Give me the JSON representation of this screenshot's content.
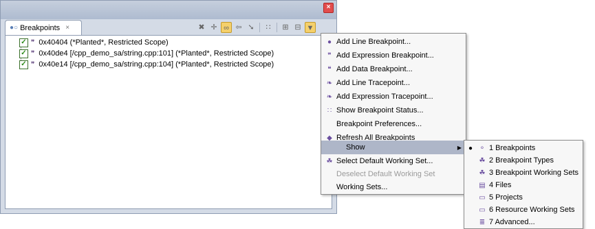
{
  "view": {
    "tab_title": "Breakpoints",
    "tab_close": "×",
    "close_glyph": "×",
    "toolbar_icons": [
      "remove-icon",
      "remove-all-icon",
      "link-icon",
      "goto-icon",
      "skip-icon",
      "status-icon",
      "expand-all-icon",
      "collapse-all-icon",
      "menu-icon"
    ],
    "breakpoints": [
      {
        "text": "0x40404  (*Planted*, Restricted Scope)"
      },
      {
        "text": "0x40de4  [/cpp_demo_sa/string.cpp:101] (*Planted*, Restricted Scope)"
      },
      {
        "text": "0x40e14  [/cpp_demo_sa/string.cpp:104] (*Planted*, Restricted Scope)"
      }
    ]
  },
  "menu": {
    "items": [
      {
        "label": "Add Line Breakpoint...",
        "icon": "line-breakpoint-icon",
        "glyph": "●"
      },
      {
        "label": "Add Expression Breakpoint...",
        "icon": "expression-breakpoint-icon",
        "glyph": "❞"
      },
      {
        "label": "Add Data Breakpoint...",
        "icon": "data-breakpoint-icon",
        "glyph": "❝"
      },
      {
        "label": "Add Line Tracepoint...",
        "icon": "line-tracepoint-icon",
        "glyph": "❧"
      },
      {
        "label": "Add Expression Tracepoint...",
        "icon": "expression-tracepoint-icon",
        "glyph": "❧"
      },
      {
        "label": "Show Breakpoint Status...",
        "icon": "breakpoint-status-icon",
        "glyph": "∷"
      },
      {
        "label": "Breakpoint Preferences...",
        "icon": "",
        "glyph": ""
      },
      {
        "label": "Refresh All Breakpoints",
        "icon": "refresh-icon",
        "glyph": "◆"
      }
    ],
    "show_label": "Show",
    "show_arrow": "▶",
    "items2": [
      {
        "label": "Select Default Working Set...",
        "icon": "working-set-icon",
        "glyph": "☘",
        "disabled": false
      },
      {
        "label": "Deselect Default Working Set",
        "icon": "",
        "glyph": "",
        "disabled": true
      },
      {
        "label": "Working Sets...",
        "icon": "",
        "glyph": "",
        "disabled": false
      }
    ]
  },
  "submenu": {
    "selected_bullet": "●",
    "items": [
      {
        "label": "1 Breakpoints",
        "icon": "breakpoints-icon",
        "glyph": "⚬",
        "selected": true
      },
      {
        "label": "2 Breakpoint Types",
        "icon": "breakpoint-types-icon",
        "glyph": "☘",
        "selected": false
      },
      {
        "label": "3 Breakpoint Working Sets",
        "icon": "breakpoint-working-sets-icon",
        "glyph": "☘",
        "selected": false
      },
      {
        "label": "4 Files",
        "icon": "file-icon",
        "glyph": "▤",
        "selected": false
      },
      {
        "label": "5 Projects",
        "icon": "project-folder-icon",
        "glyph": "▭",
        "selected": false
      },
      {
        "label": "6 Resource Working Sets",
        "icon": "resource-folder-icon",
        "glyph": "▭",
        "selected": false
      },
      {
        "label": "7 Advanced...",
        "icon": "advanced-icon",
        "glyph": "≣",
        "selected": false
      }
    ]
  }
}
